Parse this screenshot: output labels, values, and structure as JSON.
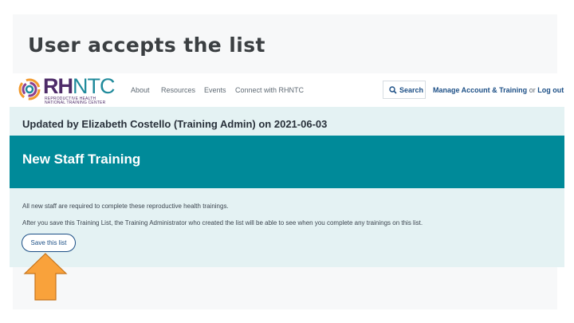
{
  "slide": {
    "title": "User accepts the list"
  },
  "site": {
    "logo": {
      "bold": "RH",
      "light": "NTC",
      "sub_line1": "REPRODUCTIVE HEALTH",
      "sub_line2": "NATIONAL TRAINING CENTER"
    },
    "nav": {
      "about": "About",
      "resources": "Resources",
      "events": "Events",
      "connect": "Connect with RHNTC",
      "search": "Search",
      "account": "Manage Account & Training",
      "or": "or",
      "logout": "Log out"
    },
    "updated_text": "Updated by Elizabeth Costello (Training Admin) on 2021-06-03",
    "list_title": "New Staff Training",
    "description1": "All new staff are required to complete these reproductive health trainings.",
    "description2": "After you save this Training List, the Training Administrator who created the list will be able to see when you complete any trainings on this list.",
    "save_button": "Save this list"
  },
  "colors": {
    "banner": "#008a99",
    "arrow": "#f9a23b",
    "link": "#1c4f86",
    "page_bg": "#e4f2f3"
  }
}
